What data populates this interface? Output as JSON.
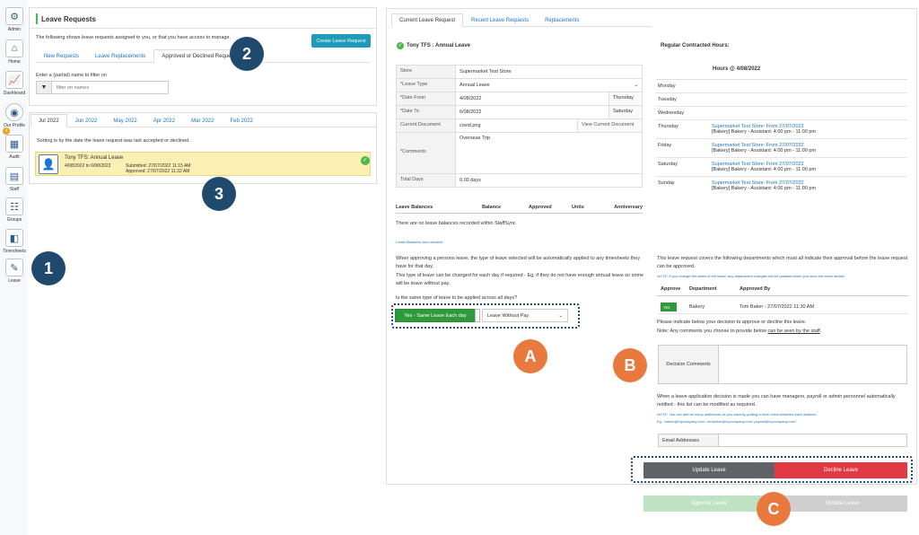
{
  "sidebar": {
    "items": [
      {
        "label": "Admin",
        "icon": "gear-icon"
      },
      {
        "label": "Home",
        "icon": "home-icon"
      },
      {
        "label": "Dashboard",
        "icon": "chart-icon"
      },
      {
        "label": "Our Profile",
        "icon": "profile-icon"
      },
      {
        "label": "Audit",
        "icon": "audit-icon"
      },
      {
        "label": "Staff",
        "icon": "staff-icon"
      },
      {
        "label": "Groups",
        "icon": "groups-icon"
      },
      {
        "label": "Timesheets",
        "icon": "timesheets-icon"
      },
      {
        "label": "Leave",
        "icon": "leave-icon"
      }
    ],
    "badge": "4"
  },
  "requests": {
    "title": "Leave Requests",
    "description": "The following shows leave requests assigned to you, or that you have access to manage.",
    "create_label": "Create Leave Request",
    "tabs": [
      "New Requests",
      "Leave Replacements",
      "Approved or Declined Requests"
    ],
    "filter_label": "Enter a (partial) name to filter on",
    "filter_placeholder": "filter on names"
  },
  "months": {
    "tabs": [
      "Jul 2022",
      "Jun 2022",
      "May 2022",
      "Apr 2022",
      "Mar 2022",
      "Feb 2022"
    ],
    "sort_note": "Sorting is by the date the leave request was last accepted or declined.",
    "card": {
      "name": "Tony TFS: Annual Leave",
      "dates": "4/08/2022 to 6/08/2022",
      "submitted": "Submitted: 27/07/2022 11:15 AM",
      "approved": "Approved: 27/07/2022 11:32 AM"
    }
  },
  "detail": {
    "tabs": [
      "Current Leave Request",
      "Recent Leave Requests",
      "Replacements"
    ],
    "heading": "Tony TFS : Annual Leave",
    "fields": {
      "store_label": "Store",
      "store_value": "Supermarket Test Store",
      "leavetype_label": "Leave Type",
      "leavetype_value": "Annual Leave",
      "datefrom_label": "Date From",
      "datefrom_value": "4/08/2022",
      "datefrom_day": "Thursday",
      "dateto_label": "Date To",
      "dateto_value": "6/08/2022",
      "dateto_day": "Saturday",
      "doc_label": "Current Document",
      "doc_value": "covid.png",
      "doc_link": "View Current Document",
      "comments_label": "Comments",
      "comments_value": "Overseas Trip",
      "totaldays_label": "Total Days",
      "totaldays_value": "0.00 days"
    },
    "balances": {
      "headers": [
        "Leave Balances",
        "Balance",
        "Approved",
        "Units",
        "Anniversary"
      ],
      "empty": "There are no leave balances recorded within StaffSync",
      "note": "Leave Balances last checked"
    },
    "approve_text1": "When approving a persons leave, the type of leave selected will be automatically applied to any timesheets they have for that day.",
    "approve_text2": "This type of leave can be changed for each day if required - Eg, if they do not have enough annual leave so some will be leave without pay.",
    "same_question": "Is the same type of leave to be applied across all days?",
    "same_toggle": "Yes - Same Leave Each day",
    "same_select": "Leave Without Pay"
  },
  "hours": {
    "title": "Regular Contracted Hours:",
    "subtitle": "Hours @ 4/08/2022",
    "days": [
      {
        "day": "Monday",
        "store": "",
        "shift": ""
      },
      {
        "day": "Tuesday",
        "store": "",
        "shift": ""
      },
      {
        "day": "Wednesday",
        "store": "",
        "shift": ""
      },
      {
        "day": "Thursday",
        "store": "Supermarket Test Store: From 27/07/2022",
        "shift": "[Bakery] Bakery - Assistant: 4:00 pm - 11:00 pm"
      },
      {
        "day": "Friday",
        "store": "Supermarket Test Store: From 27/07/2022",
        "shift": "[Bakery] Bakery - Assistant: 4:00 pm - 11:00 pm"
      },
      {
        "day": "Saturday",
        "store": "Supermarket Test Store: From 27/07/2022",
        "shift": "[Bakery] Bakery - Assistant: 4:00 pm - 11:00 pm"
      },
      {
        "day": "Sunday",
        "store": "Supermarket Test Store: From 27/07/2022",
        "shift": "[Bakery] Bakery - Assistant: 4:00 pm - 11:00 pm"
      }
    ]
  },
  "approval": {
    "covers": "This leave request covers the following departments which must all indicate their approval before the leave request can be approved.",
    "note": "NOTE: If you change the dates of the leave, any department changes will be updated when you save the leave details.",
    "headers": [
      "Approve",
      "Department",
      "Approved By"
    ],
    "row": {
      "toggle": "Yes",
      "department": "Bakery",
      "by": "Tom Baker - 27/07/2022 11:30 AM"
    },
    "indicate": "Please indicate below your decision to approve or decline this leave.",
    "note2_prefix": "Note: Any comments you choose to provide below ",
    "note2_link": "can be seen by the staff",
    "note2_suffix": ".",
    "decision_label": "Decision Comments",
    "notify_text": "When a leave application decision is made you can have managers, payroll or admin personnel automatically notified - this list can be modified as required.",
    "notify_note": "NOTE: You can add as many addresses as you want by putting a semi-colon between each address.",
    "notify_eg": "Eg. \"admin@mycompany.com; reception@mycompany.com; payroll@mycompany.com\"",
    "email_label": "Email Addresses",
    "update_label": "Update Leave",
    "decline_label": "Decline Leave",
    "approve_faded": "Approve Leave",
    "update_faded": "Update Leave"
  },
  "callouts": {
    "one": "1",
    "two": "2",
    "three": "3",
    "a": "A",
    "b": "B",
    "c": "C"
  },
  "colors": {
    "accent": "#1e9bb8",
    "green": "#2f9a3c",
    "red": "#e23a45",
    "dark": "#1f4a6e",
    "orange": "#e8793f",
    "highlight": "#fcefb4"
  }
}
